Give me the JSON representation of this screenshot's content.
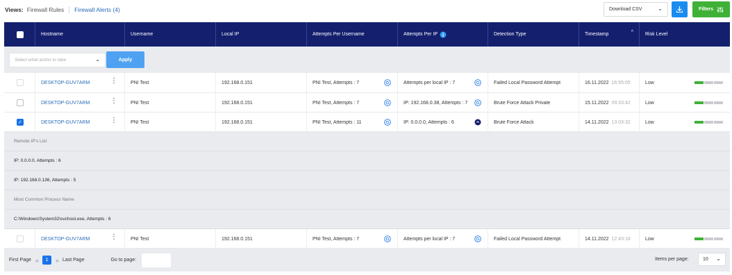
{
  "views": {
    "label": "Views:",
    "tabs": [
      {
        "label": "Firewall Rules",
        "active": false
      },
      {
        "label": "Firewall Alerts (4)",
        "active": true
      }
    ]
  },
  "toolbar": {
    "download_select_value": "Download CSV",
    "download_icon": "download-icon",
    "filters_label": "Filters",
    "filters_icon": "sliders-icon"
  },
  "table": {
    "columns": [
      "Hostname",
      "Username",
      "Local IP",
      "Attempts Per Username",
      "Attempts Per IP",
      "Detection Type",
      "Timestamp",
      "Risk Level"
    ],
    "action_placeholder": "Select what action to take",
    "apply_label": "Apply",
    "rows": [
      {
        "checked": false,
        "hostname": "DESKTOP-GUV7ARM",
        "username": "PNI Test",
        "local_ip": "192.168.0.151",
        "attempts_user": "PNI Test, Attempts : 7",
        "attempts_ip": "Attempts per local IP : 7",
        "detection": "Failed Local Password Attempt",
        "date": "16.11.2022",
        "time": "16:55:05",
        "risk": "Low",
        "risk_level": 1
      },
      {
        "checked": false,
        "hostname": "DESKTOP-GUV7ARM",
        "username": "PNI Test",
        "local_ip": "192.168.0.151",
        "attempts_user": "PNI Test, Attempts : 7",
        "attempts_ip": "IP: 192.168.0.38, Attempts : 7",
        "detection": "Brute Force Attack Private",
        "date": "15.11.2022",
        "time": "09:33:42",
        "risk": "Low",
        "risk_level": 1
      },
      {
        "checked": true,
        "hostname": "DESKTOP-GUV7ARM",
        "username": "PNI Test",
        "local_ip": "192.168.0.151",
        "attempts_user": "PNI Test, Attempts : 11",
        "attempts_ip": "IP: 0.0.0.0, Attempts : 6",
        "detection": "Brute Force Attack",
        "date": "14.11.2022",
        "time": "13:03:32",
        "risk": "Low",
        "risk_level": 1
      }
    ],
    "expanded": {
      "remote_header": "Remote IP's List",
      "remote_items": [
        "IP: 0.0.0.0, Attempts : 6",
        "IP: 192.168.0.136, Attempts : 5"
      ],
      "process_header": "Most Common Process Name",
      "process_items": [
        "C:\\Windows\\System32\\svchost.exe, Attempts : 6"
      ]
    },
    "last_row": {
      "checked": false,
      "hostname": "DESKTOP-GUV7ARM",
      "username": "PNI Test",
      "local_ip": "192.168.0.151",
      "attempts_user": "PNI Test, Attempts : 7",
      "attempts_ip": "Attempts per local IP : 7",
      "detection": "Failed Local Password Attempt",
      "date": "14.11.2022",
      "time": "12:43:18",
      "risk": "Low",
      "risk_level": 1
    }
  },
  "pagination": {
    "first_label": "First Page",
    "current_page": "1",
    "last_label": "Last Page",
    "goto_label": "Go to page:",
    "items_per_page_label": "Items per page:",
    "items_per_page_value": "10"
  },
  "colors": {
    "header_bg": "#141f6e",
    "accent": "#1a73e8",
    "success": "#3fb137"
  }
}
